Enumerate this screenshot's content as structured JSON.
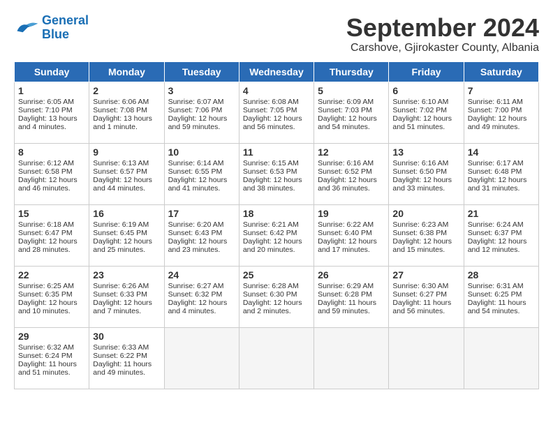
{
  "logo": {
    "line1": "General",
    "line2": "Blue"
  },
  "title": "September 2024",
  "subtitle": "Carshove, Gjirokaster County, Albania",
  "headers": [
    "Sunday",
    "Monday",
    "Tuesday",
    "Wednesday",
    "Thursday",
    "Friday",
    "Saturday"
  ],
  "weeks": [
    [
      {
        "day": "1",
        "info": "Sunrise: 6:05 AM\nSunset: 7:10 PM\nDaylight: 13 hours\nand 4 minutes."
      },
      {
        "day": "2",
        "info": "Sunrise: 6:06 AM\nSunset: 7:08 PM\nDaylight: 13 hours\nand 1 minute."
      },
      {
        "day": "3",
        "info": "Sunrise: 6:07 AM\nSunset: 7:06 PM\nDaylight: 12 hours\nand 59 minutes."
      },
      {
        "day": "4",
        "info": "Sunrise: 6:08 AM\nSunset: 7:05 PM\nDaylight: 12 hours\nand 56 minutes."
      },
      {
        "day": "5",
        "info": "Sunrise: 6:09 AM\nSunset: 7:03 PM\nDaylight: 12 hours\nand 54 minutes."
      },
      {
        "day": "6",
        "info": "Sunrise: 6:10 AM\nSunset: 7:02 PM\nDaylight: 12 hours\nand 51 minutes."
      },
      {
        "day": "7",
        "info": "Sunrise: 6:11 AM\nSunset: 7:00 PM\nDaylight: 12 hours\nand 49 minutes."
      }
    ],
    [
      {
        "day": "8",
        "info": "Sunrise: 6:12 AM\nSunset: 6:58 PM\nDaylight: 12 hours\nand 46 minutes."
      },
      {
        "day": "9",
        "info": "Sunrise: 6:13 AM\nSunset: 6:57 PM\nDaylight: 12 hours\nand 44 minutes."
      },
      {
        "day": "10",
        "info": "Sunrise: 6:14 AM\nSunset: 6:55 PM\nDaylight: 12 hours\nand 41 minutes."
      },
      {
        "day": "11",
        "info": "Sunrise: 6:15 AM\nSunset: 6:53 PM\nDaylight: 12 hours\nand 38 minutes."
      },
      {
        "day": "12",
        "info": "Sunrise: 6:16 AM\nSunset: 6:52 PM\nDaylight: 12 hours\nand 36 minutes."
      },
      {
        "day": "13",
        "info": "Sunrise: 6:16 AM\nSunset: 6:50 PM\nDaylight: 12 hours\nand 33 minutes."
      },
      {
        "day": "14",
        "info": "Sunrise: 6:17 AM\nSunset: 6:48 PM\nDaylight: 12 hours\nand 31 minutes."
      }
    ],
    [
      {
        "day": "15",
        "info": "Sunrise: 6:18 AM\nSunset: 6:47 PM\nDaylight: 12 hours\nand 28 minutes."
      },
      {
        "day": "16",
        "info": "Sunrise: 6:19 AM\nSunset: 6:45 PM\nDaylight: 12 hours\nand 25 minutes."
      },
      {
        "day": "17",
        "info": "Sunrise: 6:20 AM\nSunset: 6:43 PM\nDaylight: 12 hours\nand 23 minutes."
      },
      {
        "day": "18",
        "info": "Sunrise: 6:21 AM\nSunset: 6:42 PM\nDaylight: 12 hours\nand 20 minutes."
      },
      {
        "day": "19",
        "info": "Sunrise: 6:22 AM\nSunset: 6:40 PM\nDaylight: 12 hours\nand 17 minutes."
      },
      {
        "day": "20",
        "info": "Sunrise: 6:23 AM\nSunset: 6:38 PM\nDaylight: 12 hours\nand 15 minutes."
      },
      {
        "day": "21",
        "info": "Sunrise: 6:24 AM\nSunset: 6:37 PM\nDaylight: 12 hours\nand 12 minutes."
      }
    ],
    [
      {
        "day": "22",
        "info": "Sunrise: 6:25 AM\nSunset: 6:35 PM\nDaylight: 12 hours\nand 10 minutes."
      },
      {
        "day": "23",
        "info": "Sunrise: 6:26 AM\nSunset: 6:33 PM\nDaylight: 12 hours\nand 7 minutes."
      },
      {
        "day": "24",
        "info": "Sunrise: 6:27 AM\nSunset: 6:32 PM\nDaylight: 12 hours\nand 4 minutes."
      },
      {
        "day": "25",
        "info": "Sunrise: 6:28 AM\nSunset: 6:30 PM\nDaylight: 12 hours\nand 2 minutes."
      },
      {
        "day": "26",
        "info": "Sunrise: 6:29 AM\nSunset: 6:28 PM\nDaylight: 11 hours\nand 59 minutes."
      },
      {
        "day": "27",
        "info": "Sunrise: 6:30 AM\nSunset: 6:27 PM\nDaylight: 11 hours\nand 56 minutes."
      },
      {
        "day": "28",
        "info": "Sunrise: 6:31 AM\nSunset: 6:25 PM\nDaylight: 11 hours\nand 54 minutes."
      }
    ],
    [
      {
        "day": "29",
        "info": "Sunrise: 6:32 AM\nSunset: 6:24 PM\nDaylight: 11 hours\nand 51 minutes."
      },
      {
        "day": "30",
        "info": "Sunrise: 6:33 AM\nSunset: 6:22 PM\nDaylight: 11 hours\nand 49 minutes."
      },
      {
        "day": "",
        "info": ""
      },
      {
        "day": "",
        "info": ""
      },
      {
        "day": "",
        "info": ""
      },
      {
        "day": "",
        "info": ""
      },
      {
        "day": "",
        "info": ""
      }
    ]
  ]
}
